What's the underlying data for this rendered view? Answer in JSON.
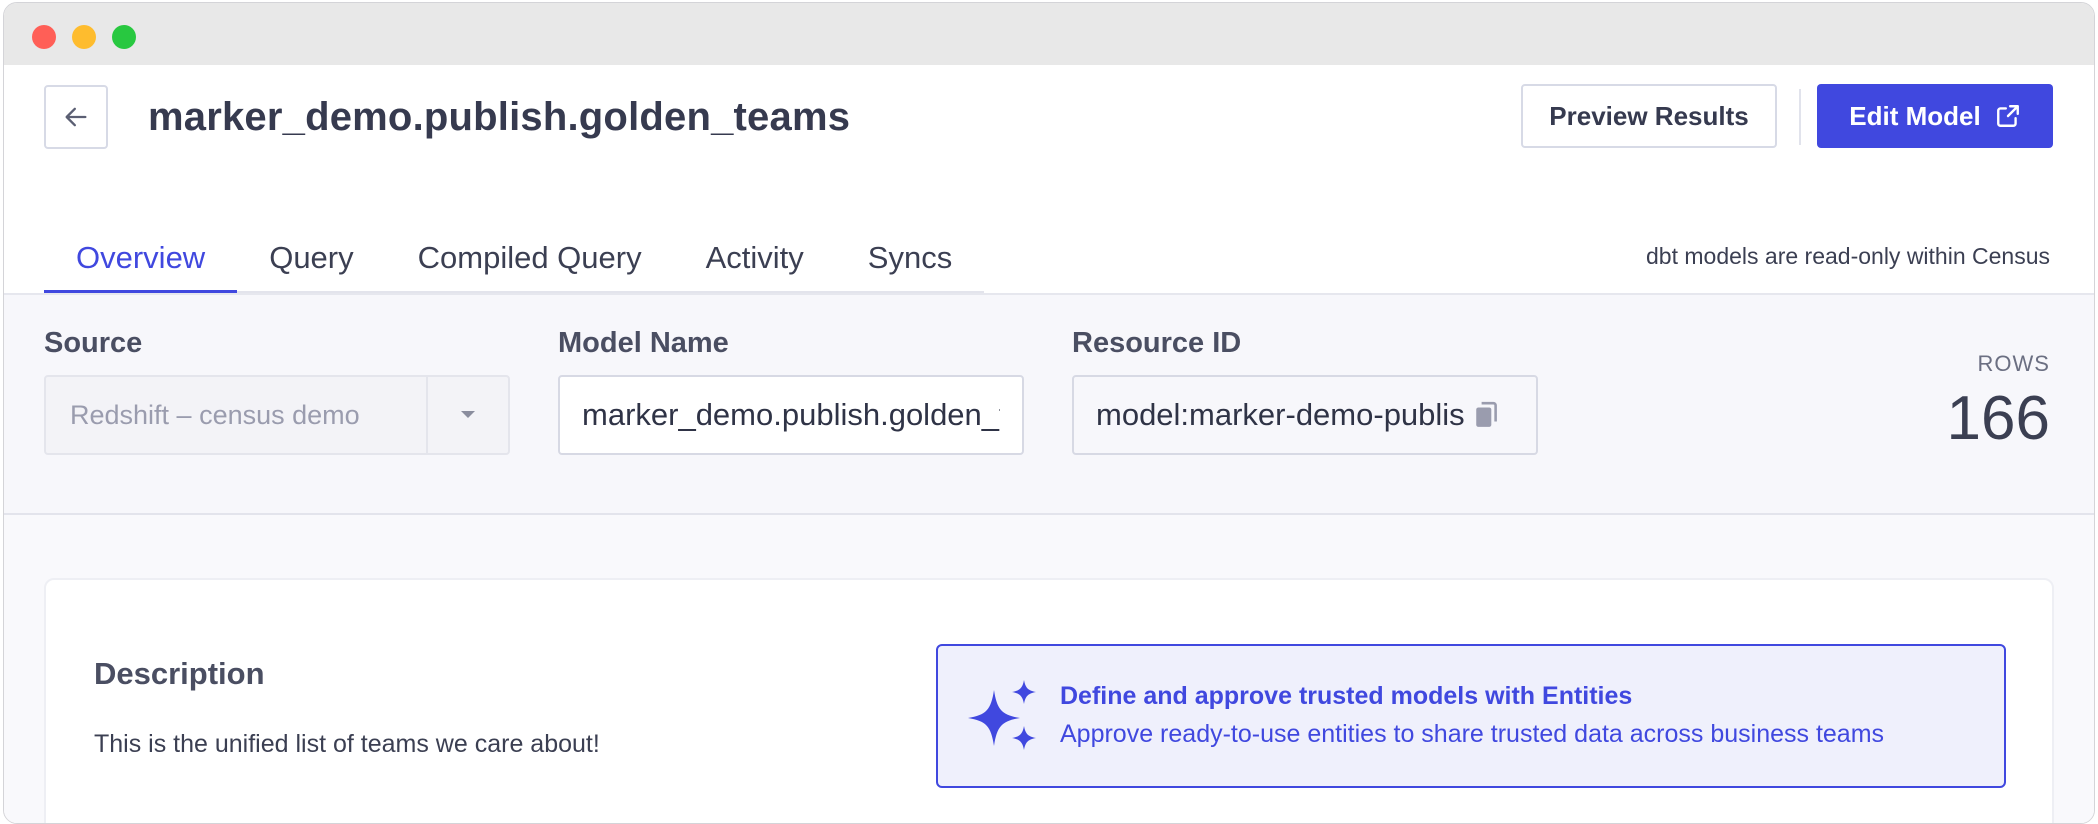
{
  "header": {
    "title": "marker_demo.publish.golden_teams",
    "preview_label": "Preview Results",
    "edit_label": "Edit Model"
  },
  "tabs": [
    {
      "label": "Overview",
      "active": true
    },
    {
      "label": "Query",
      "active": false
    },
    {
      "label": "Compiled Query",
      "active": false
    },
    {
      "label": "Activity",
      "active": false
    },
    {
      "label": "Syncs",
      "active": false
    }
  ],
  "tab_note": "dbt models are read-only within Census",
  "fields": {
    "source_label": "Source",
    "source_value": "Redshift – census demo",
    "model_name_label": "Model Name",
    "model_name_value": "marker_demo.publish.golden_teams",
    "resource_id_label": "Resource ID",
    "resource_id_value": "model:marker-demo-publish-golden-teams"
  },
  "rows": {
    "label": "ROWS",
    "value": "166"
  },
  "description": {
    "title": "Description",
    "text": "This is the unified list of teams we care about!"
  },
  "promo": {
    "title": "Define and approve trusted models with Entities",
    "subtitle": "Approve ready-to-use entities to share trusted data across business teams",
    "icon": "sparkles-icon"
  },
  "colors": {
    "accent": "#4048df",
    "panel_bg": "#f7f7fb",
    "title_bar": "#e8e8e8"
  }
}
